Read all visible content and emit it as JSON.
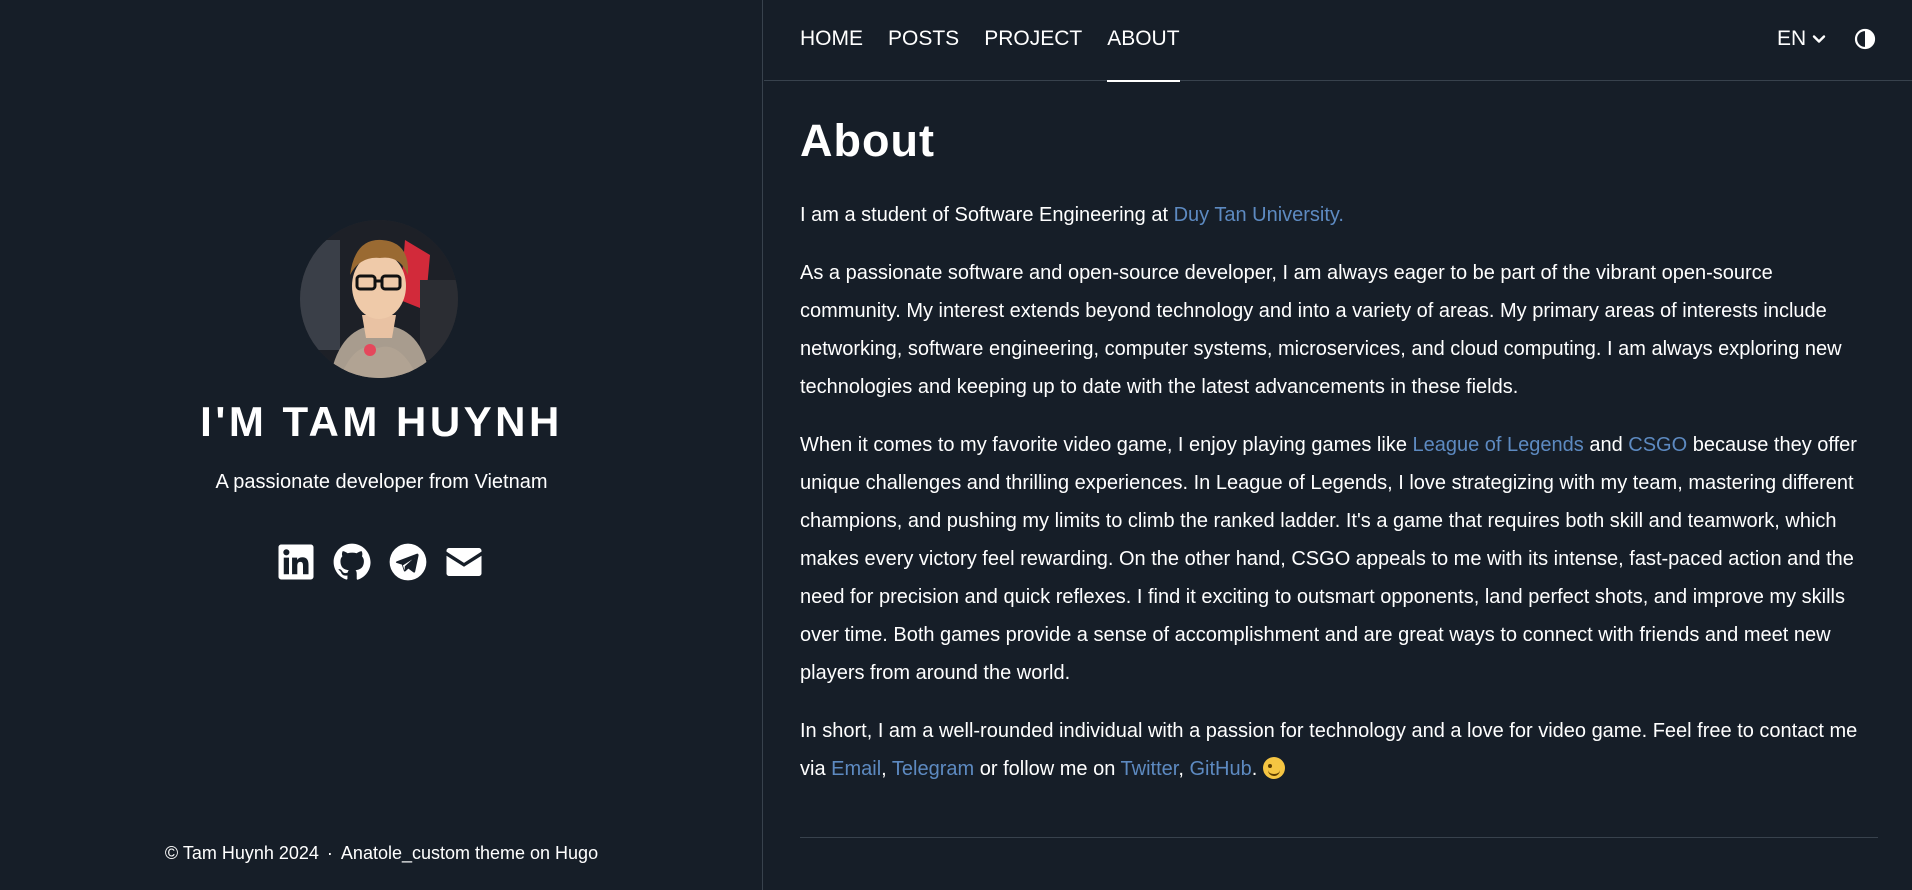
{
  "sidebar": {
    "name": "I'M TAM HUYNH",
    "tagline": "A passionate developer from Vietnam",
    "socials": [
      "linkedin-icon",
      "github-icon",
      "telegram-icon",
      "email-icon"
    ],
    "footer_copyright": "© Tam Huynh 2024",
    "footer_sep": "·",
    "footer_theme": "Anatole_custom theme on Hugo"
  },
  "nav": {
    "items": [
      "HOME",
      "POSTS",
      "PROJECT",
      "ABOUT"
    ],
    "active": "ABOUT",
    "language": "EN"
  },
  "main": {
    "title": "About",
    "p1": {
      "text": "I am a student of Software Engineering at ",
      "link": "Duy Tan University."
    },
    "p2": "As a passionate software and open-source developer, I am always eager to be part of the vibrant open-source community. My interest extends beyond technology and into a variety of areas. My primary areas of interests include networking, software engineering, computer systems, microservices, and cloud computing. I am always exploring new technologies and keeping up to date with the latest advancements in these fields.",
    "p3": {
      "t1": "When it comes to my favorite video game, I enjoy playing games like ",
      "link1": "League of Legends",
      "t2": " and ",
      "link2": "CSGO",
      "t3": " because they offer unique challenges and thrilling experiences. In League of Legends, I love strategizing with my team, mastering different champions, and pushing my limits to climb the ranked ladder. It's a game that requires both skill and teamwork, which makes every victory feel rewarding. On the other hand, CSGO appeals to me with its intense, fast-paced action and the need for precision and quick reflexes. I find it exciting to outsmart opponents, land perfect shots, and improve my skills over time. Both games provide a sense of accomplishment and are great ways to connect with friends and meet new players from around the world."
    },
    "p4": {
      "t1": "In short, I am a well-rounded individual with a passion for technology and a love for video game. Feel free to contact me via ",
      "link_email": "Email",
      "sep1": ", ",
      "link_telegram": "Telegram",
      "t2": " or follow me on ",
      "link_twitter": "Twitter",
      "sep2": ", ",
      "link_github": "GitHub",
      "t3": "."
    }
  },
  "colors": {
    "background": "#161e28",
    "link": "#5d8ac1",
    "divider": "#38424d"
  }
}
